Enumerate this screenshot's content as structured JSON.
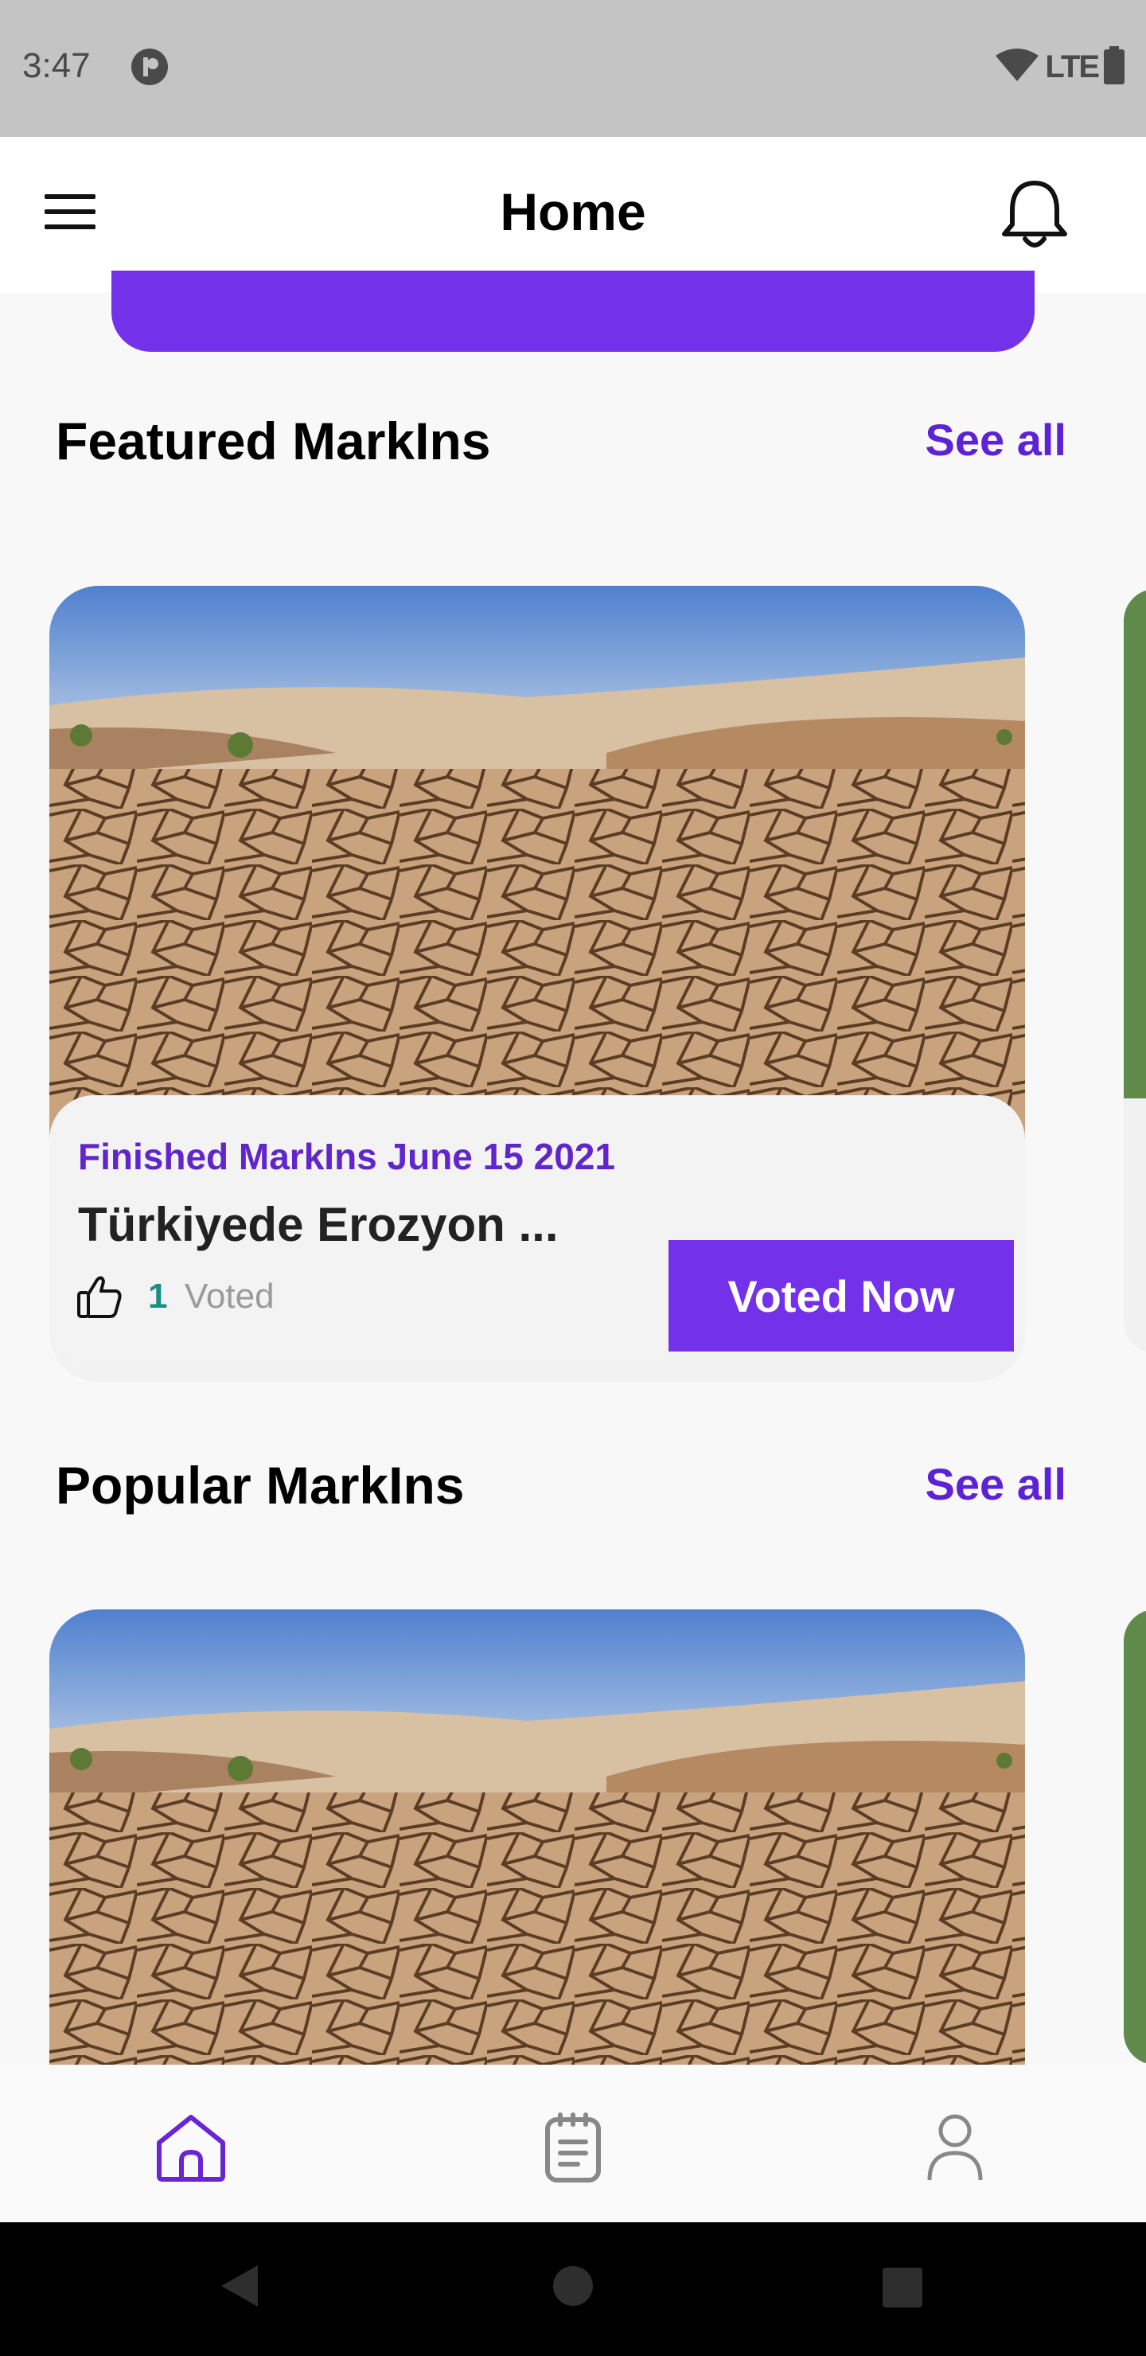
{
  "status_bar": {
    "time": "3:47",
    "network": "LTE"
  },
  "header": {
    "title": "Home",
    "menu_icon": "menu-icon",
    "bell_icon": "bell-icon"
  },
  "featured": {
    "title": "Featured MarkIns",
    "see_all": "See all",
    "card": {
      "date_label": "Finished MarkIns June 15 2021",
      "title": "Türkiyede Erozyon ...",
      "vote_count": "1",
      "vote_label": "Voted",
      "button_label": "Voted Now"
    }
  },
  "popular": {
    "title": "Popular MarkIns",
    "see_all": "See all"
  },
  "bottom_nav": {
    "items": [
      {
        "icon": "home-icon",
        "active": true
      },
      {
        "icon": "notes-icon",
        "active": false
      },
      {
        "icon": "profile-icon",
        "active": false
      }
    ]
  },
  "colors": {
    "accent": "#7431ea",
    "accent_text": "#5e22d6",
    "vote_count": "#1a8f84"
  }
}
